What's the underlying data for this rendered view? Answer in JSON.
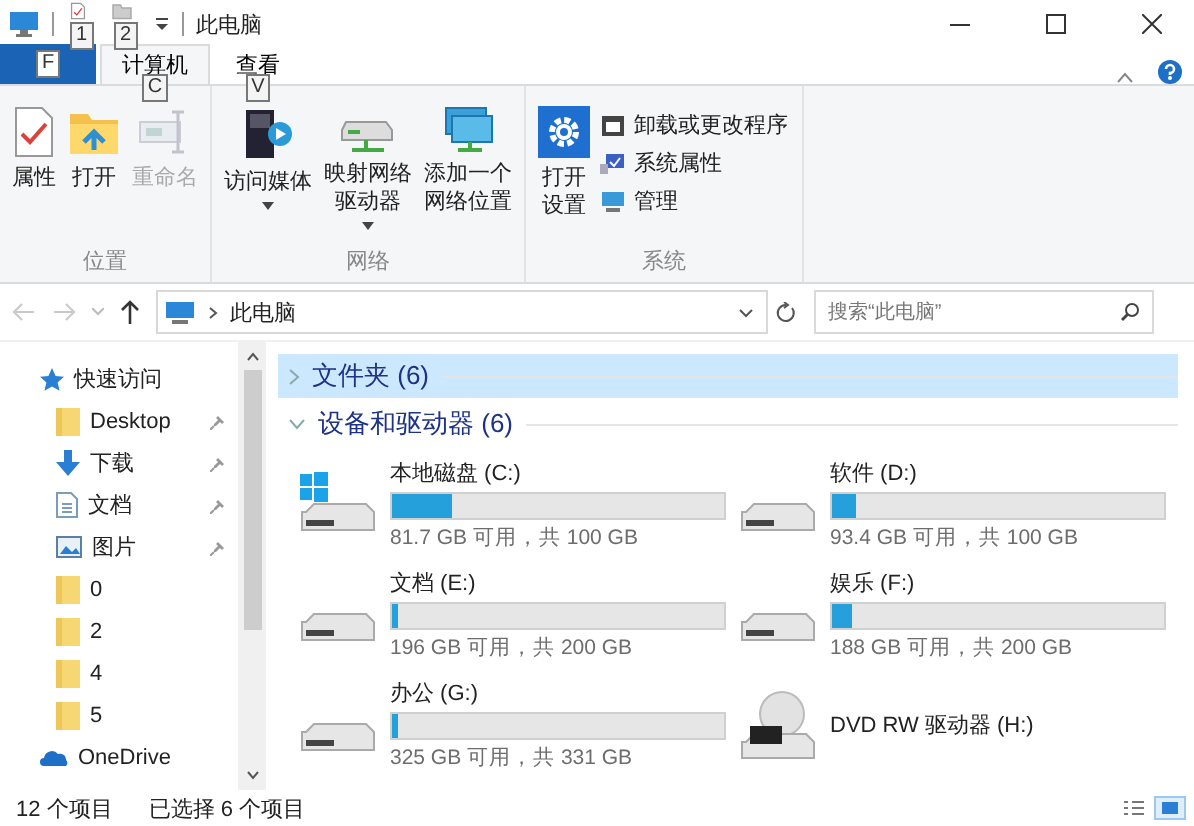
{
  "window": {
    "title": "此电脑"
  },
  "quick_access_toolbar": [
    {
      "kind": "properties",
      "keytip": "1"
    },
    {
      "kind": "new-folder",
      "keytip": "2"
    }
  ],
  "ribbon": {
    "file_tab": {
      "keytip": "F"
    },
    "tabs": [
      {
        "label": "计算机",
        "keytip": "C",
        "selected": true
      },
      {
        "label": "查看",
        "keytip": "V",
        "selected": false
      }
    ],
    "groups": [
      {
        "label": "位置",
        "commands": [
          {
            "kind": "properties",
            "lines": [
              "属性"
            ],
            "disabled": false,
            "dropdown": false
          },
          {
            "kind": "open",
            "lines": [
              "打开"
            ],
            "disabled": false,
            "dropdown": false
          },
          {
            "kind": "rename",
            "lines": [
              "重命名"
            ],
            "disabled": true,
            "dropdown": false
          }
        ]
      },
      {
        "label": "网络",
        "commands": [
          {
            "kind": "media",
            "lines": [
              "访问媒体"
            ],
            "disabled": false,
            "dropdown": true
          },
          {
            "kind": "map-drive",
            "lines": [
              "映射网络",
              "驱动器"
            ],
            "disabled": false,
            "dropdown": true
          },
          {
            "kind": "net-location",
            "lines": [
              "添加一个",
              "网络位置"
            ],
            "disabled": false,
            "dropdown": false
          }
        ]
      },
      {
        "label": "系统",
        "commands": [
          {
            "kind": "settings",
            "lines": [
              "打开",
              "设置"
            ],
            "disabled": false,
            "dropdown": false
          }
        ],
        "small_commands": [
          {
            "kind": "uninstall",
            "label": "卸载或更改程序"
          },
          {
            "kind": "system-properties",
            "label": "系统属性"
          },
          {
            "kind": "manage",
            "label": "管理"
          }
        ]
      }
    ]
  },
  "navigation": {
    "back_disabled": true,
    "forward_disabled": true,
    "address": [
      "此电脑"
    ],
    "search": {
      "placeholder": "搜索“此电脑”"
    }
  },
  "sidebar": {
    "items": [
      {
        "label": "快速访问",
        "kind": "star",
        "pinned": false,
        "children": [
          {
            "label": "Desktop",
            "kind": "folder",
            "pinned": true
          },
          {
            "label": "下载",
            "kind": "download",
            "pinned": true
          },
          {
            "label": "文档",
            "kind": "document",
            "pinned": true
          },
          {
            "label": "图片",
            "kind": "picture",
            "pinned": true
          },
          {
            "label": "0",
            "kind": "folder",
            "pinned": false
          },
          {
            "label": "2",
            "kind": "folder",
            "pinned": false
          },
          {
            "label": "4",
            "kind": "folder",
            "pinned": false
          },
          {
            "label": "5",
            "kind": "folder",
            "pinned": false
          }
        ]
      },
      {
        "label": "OneDrive",
        "kind": "cloud",
        "pinned": false
      }
    ]
  },
  "sections": [
    {
      "title": "文件夹 (6)",
      "expanded": false,
      "selected": true
    },
    {
      "title": "设备和驱动器 (6)",
      "expanded": true,
      "selected": false,
      "drives": [
        {
          "name": "本地磁盘 (C:)",
          "kind": "system-disk",
          "level": 0.18,
          "space": "81.7 GB 可用，共 100 GB"
        },
        {
          "name": "软件 (D:)",
          "kind": "disk",
          "level": 0.07,
          "space": "93.4 GB 可用，共 100 GB"
        },
        {
          "name": "文档 (E:)",
          "kind": "disk",
          "level": 0.02,
          "space": "196 GB 可用，共 200 GB"
        },
        {
          "name": "娱乐 (F:)",
          "kind": "disk",
          "level": 0.06,
          "space": "188 GB 可用，共 200 GB"
        },
        {
          "name": "办公 (G:)",
          "kind": "disk",
          "level": 0.02,
          "space": "325 GB 可用，共 331 GB"
        },
        {
          "name": "DVD RW 驱动器 (H:)",
          "kind": "dvd"
        }
      ]
    }
  ],
  "status_bar": {
    "texts": [
      "12 个项目",
      "已选择 6 个项目"
    ],
    "view_modes": [
      {
        "kind": "details",
        "selected": false
      },
      {
        "kind": "large-icons",
        "selected": true
      }
    ]
  }
}
